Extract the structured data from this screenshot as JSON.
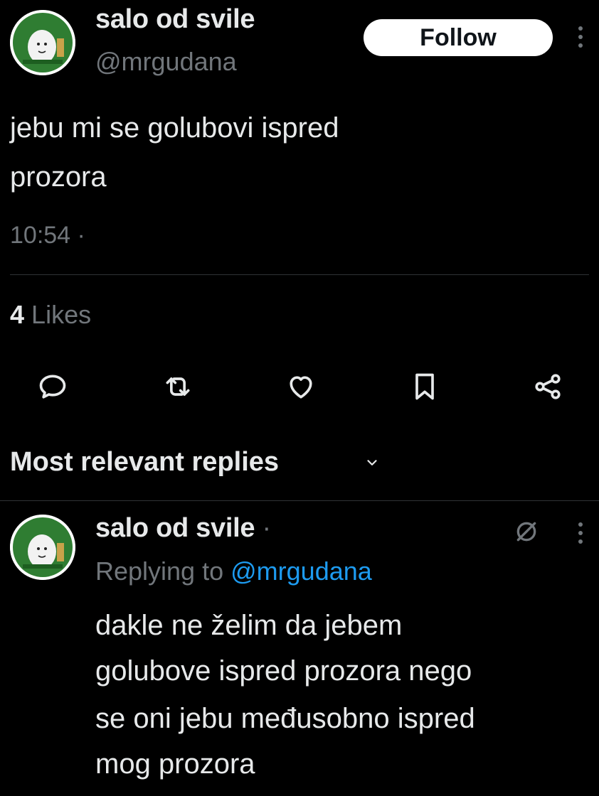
{
  "tweet": {
    "author_name": "salo od svile",
    "author_handle": "@mrgudana",
    "follow_label": "Follow",
    "more_icon": "more-vertical-icon",
    "text_line1": "jebu mi se golubovi ispred",
    "text_line2": "prozora",
    "time": "10:54 ·",
    "likes_count": "4",
    "likes_label": "Likes"
  },
  "actions": [
    {
      "icon": "reply-icon"
    },
    {
      "icon": "retweet-icon"
    },
    {
      "icon": "heart-icon"
    },
    {
      "icon": "bookmark-icon"
    },
    {
      "icon": "share-icon"
    }
  ],
  "replies_section": {
    "title": "Most relevant replies",
    "chevron": "⌄"
  },
  "reply": {
    "author_name": "salo od svile",
    "dot": "·",
    "replying_to_label": "Replying to",
    "replying_to_handle": "@mrgudana",
    "line1": "dakle ne želim da jebem",
    "line2": "golubove ispred prozora nego",
    "line3": "se oni jebu međusobno ispred",
    "line4": "mog prozora"
  },
  "colors": {
    "background": "#000000",
    "text_primary": "#e7e9ea",
    "text_secondary": "#71767b",
    "accent_link": "#1d9bf0",
    "avatar_ring": "#3a8a3a"
  }
}
